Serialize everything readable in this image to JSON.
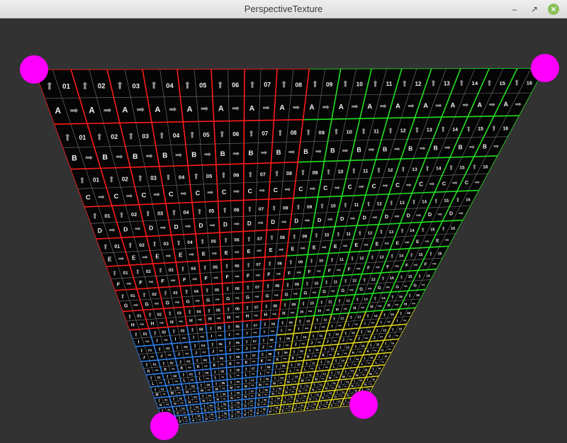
{
  "window": {
    "title": "PerspectiveTexture",
    "minimize_icon": "minimize-icon",
    "maximize_icon": "maximize-icon",
    "close_icon": "close-icon"
  },
  "texture": {
    "background": "#050505",
    "quadrant_colors": {
      "top_left": "#ff1a1a",
      "top_right": "#22e022",
      "bottom_left": "#2f7fe8",
      "bottom_right": "#d8d020"
    },
    "fine_grid_color": "#6a6a6a",
    "row_letters": [
      "A",
      "B",
      "C",
      "D",
      "E",
      "F",
      "G",
      "H",
      "I",
      "J",
      "K",
      "L",
      "M",
      "N",
      "O",
      "P"
    ],
    "column_numbers": [
      "01",
      "02",
      "03",
      "04",
      "05",
      "06",
      "07",
      "08",
      "09",
      "10",
      "11",
      "12",
      "13",
      "14",
      "15",
      "16"
    ]
  },
  "handles": {
    "color": "#ff00ff",
    "count": 4
  }
}
